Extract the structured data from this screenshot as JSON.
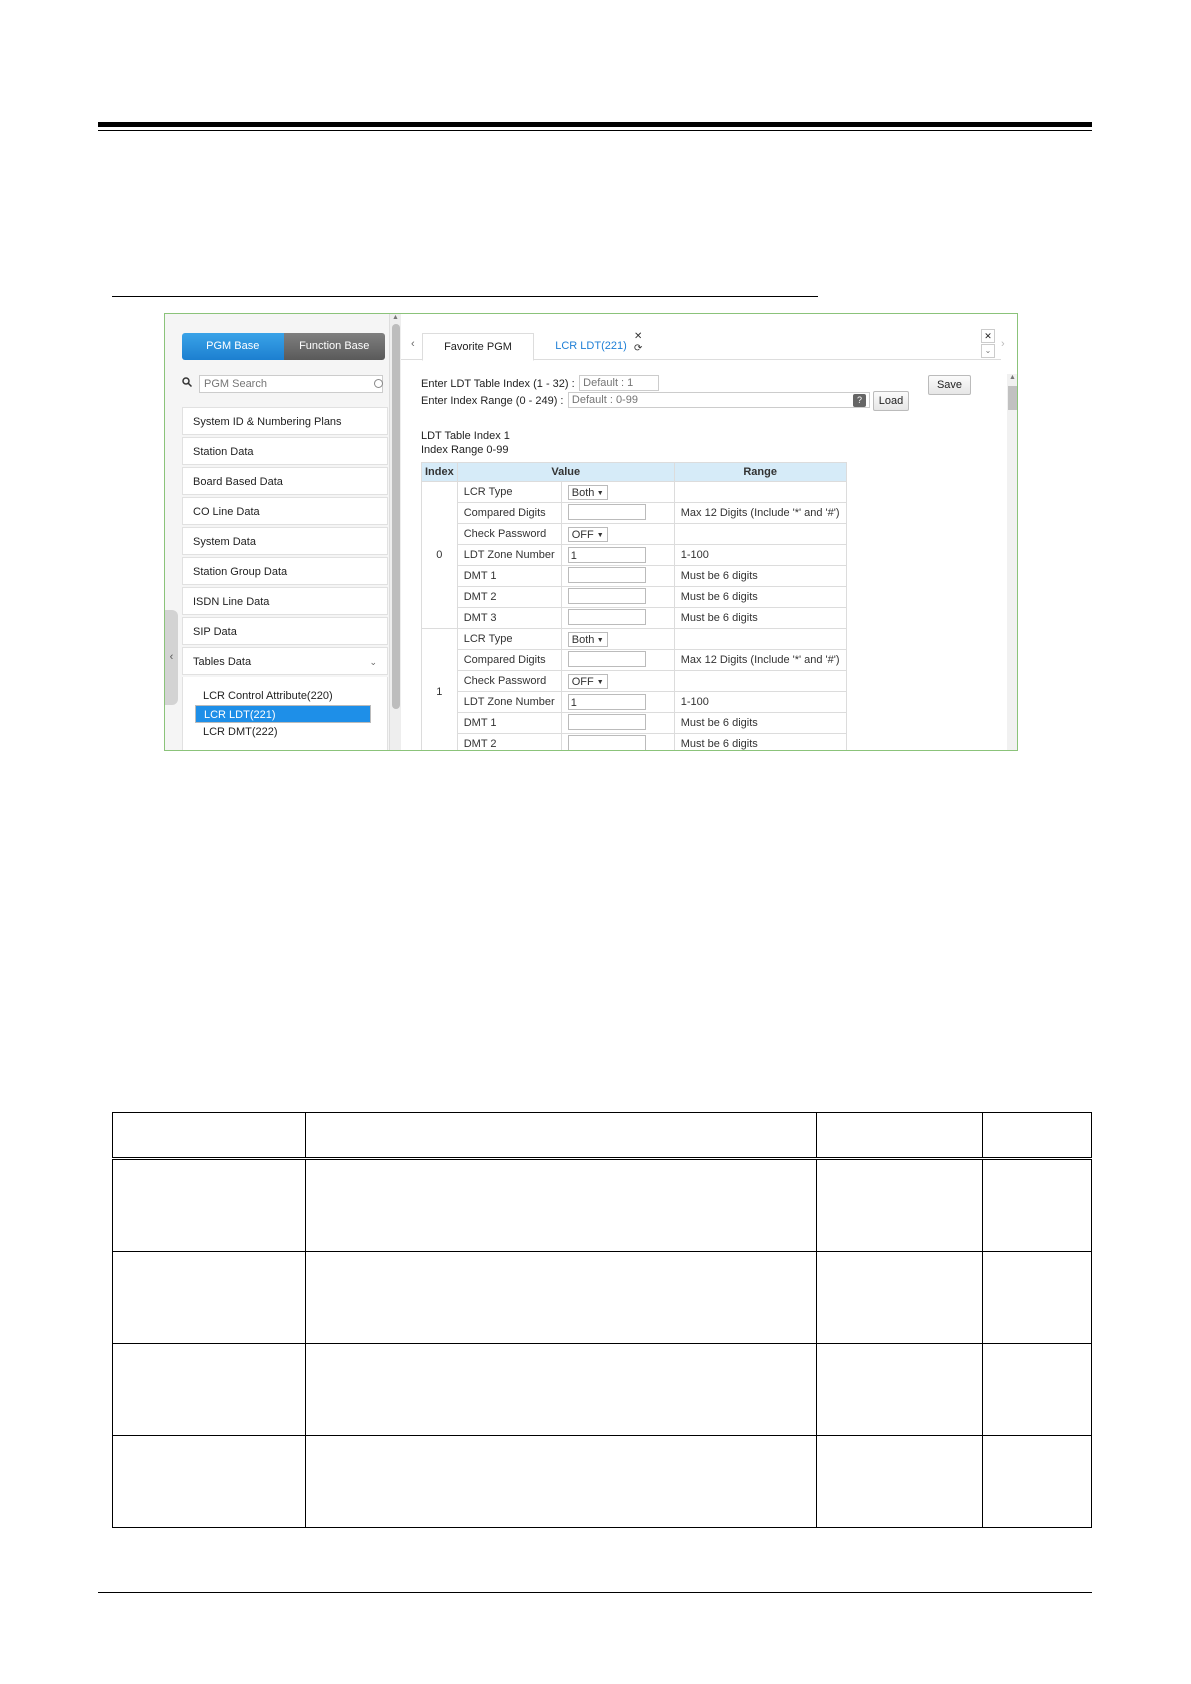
{
  "sidebar": {
    "pgm_base": "PGM Base",
    "function_base": "Function Base",
    "search_placeholder": "PGM Search",
    "items": [
      {
        "label": "System ID & Numbering Plans"
      },
      {
        "label": "Station Data"
      },
      {
        "label": "Board Based Data"
      },
      {
        "label": "CO Line Data"
      },
      {
        "label": "System Data"
      },
      {
        "label": "Station Group Data"
      },
      {
        "label": "ISDN Line Data"
      },
      {
        "label": "SIP Data"
      },
      {
        "label": "Tables Data"
      }
    ],
    "sub_items": [
      {
        "label": "LCR Control Attribute(220)"
      },
      {
        "label": "LCR LDT(221)"
      },
      {
        "label": "LCR DMT(222)"
      }
    ]
  },
  "tabs": {
    "favorite": "Favorite PGM",
    "active": "LCR LDT(221)"
  },
  "form": {
    "table_index_label": "Enter LDT Table Index (1 - 32) :",
    "table_index_placeholder": "Default : 1",
    "range_label": "Enter Index Range (0 - 249) :",
    "range_placeholder": "Default : 0-99",
    "help": "?",
    "load": "Load",
    "save": "Save"
  },
  "info": {
    "line1": "LDT Table Index 1",
    "line2": "Index Range 0-99"
  },
  "grid": {
    "headers": [
      "Index",
      "Value",
      "Range"
    ],
    "groups": [
      {
        "index": "0",
        "rows": [
          {
            "label": "LCR Type",
            "type": "select",
            "value": "Both",
            "range": ""
          },
          {
            "label": "Compared Digits",
            "type": "text",
            "value": "",
            "range": "Max 12 Digits (Include '*' and '#')"
          },
          {
            "label": "Check Password",
            "type": "select",
            "value": "OFF",
            "range": ""
          },
          {
            "label": "LDT Zone Number",
            "type": "text",
            "value": "1",
            "range": "1-100"
          },
          {
            "label": "DMT 1",
            "type": "text",
            "value": "",
            "range": "Must be 6 digits"
          },
          {
            "label": "DMT 2",
            "type": "text",
            "value": "",
            "range": "Must be 6 digits"
          },
          {
            "label": "DMT 3",
            "type": "text",
            "value": "",
            "range": "Must be 6 digits"
          }
        ]
      },
      {
        "index": "1",
        "rows": [
          {
            "label": "LCR Type",
            "type": "select",
            "value": "Both",
            "range": ""
          },
          {
            "label": "Compared Digits",
            "type": "text",
            "value": "",
            "range": "Max 12 Digits (Include '*' and '#')"
          },
          {
            "label": "Check Password",
            "type": "select",
            "value": "OFF",
            "range": ""
          },
          {
            "label": "LDT Zone Number",
            "type": "text",
            "value": "1",
            "range": "1-100"
          },
          {
            "label": "DMT 1",
            "type": "text",
            "value": "",
            "range": "Must be 6 digits"
          },
          {
            "label": "DMT 2",
            "type": "text",
            "value": "",
            "range": "Must be 6 digits"
          }
        ]
      }
    ]
  }
}
